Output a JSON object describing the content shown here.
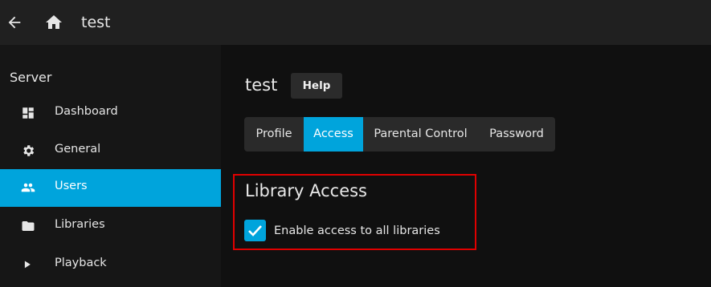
{
  "header": {
    "title": "test",
    "back_icon": "back-arrow-icon",
    "home_icon": "home-icon"
  },
  "sidebar": {
    "section_title": "Server",
    "items": [
      {
        "label": "Dashboard",
        "icon": "dashboard-icon",
        "active": false
      },
      {
        "label": "General",
        "icon": "gear-icon",
        "active": false
      },
      {
        "label": "Users",
        "icon": "people-icon",
        "active": true
      },
      {
        "label": "Libraries",
        "icon": "folder-icon",
        "active": false
      },
      {
        "label": "Playback",
        "icon": "play-icon",
        "active": false
      }
    ]
  },
  "main": {
    "title": "test",
    "help_label": "Help",
    "tabs": [
      {
        "label": "Profile",
        "active": false
      },
      {
        "label": "Access",
        "active": true
      },
      {
        "label": "Parental Control",
        "active": false
      },
      {
        "label": "Password",
        "active": false
      }
    ],
    "library_access": {
      "heading": "Library Access",
      "enable_all_label": "Enable access to all libraries",
      "enable_all_checked": true
    }
  },
  "colors": {
    "accent": "#00a4dc",
    "highlight_border": "#e00000",
    "background": "#101010",
    "topbar": "#202020"
  }
}
